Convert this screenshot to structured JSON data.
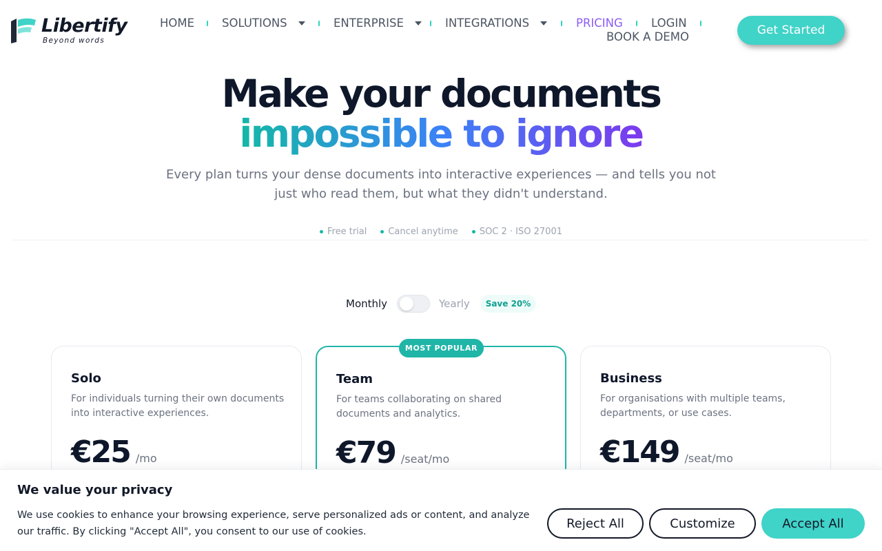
{
  "brand": {
    "name": "Libertify",
    "tagline": "Beyond words",
    "logo_icon": "libertify-logo-icon",
    "accent_color": "#40d3c8",
    "teal_color": "#14b8a6",
    "purple_color": "#7c3aed"
  },
  "nav": {
    "items": [
      {
        "label": "HOME",
        "dropdown": false,
        "active": false
      },
      {
        "label": "SOLUTIONS",
        "dropdown": true,
        "active": false
      },
      {
        "label": "ENTERPRISE",
        "dropdown": true,
        "active": false
      },
      {
        "label": "INTEGRATIONS",
        "dropdown": true,
        "active": false
      },
      {
        "label": "PRICING",
        "dropdown": false,
        "active": true
      },
      {
        "label": "LOGIN",
        "dropdown": false,
        "active": false
      },
      {
        "label": "BOOK A DEMO",
        "dropdown": false,
        "active": false
      }
    ],
    "cta_label": "Get Started"
  },
  "hero": {
    "title_line1": "Make your documents",
    "title_line2": "impossible to ignore",
    "subtitle": "Every plan turns your dense documents into interactive experiences — and tells you not just who read them, but what they didn't understand.",
    "trust": [
      "Free trial",
      "Cancel anytime",
      "SOC 2 · ISO 27001"
    ]
  },
  "billing": {
    "monthly_label": "Monthly",
    "yearly_label": "Yearly",
    "save_badge": "Save 20%",
    "selected": "Monthly"
  },
  "plans": [
    {
      "name": "Solo",
      "description": "For individuals turning their own documents into interactive experiences.",
      "price": "€25",
      "unit": "/mo",
      "popular": false
    },
    {
      "name": "Team",
      "description": "For teams collaborating on shared documents and analytics.",
      "price": "€79",
      "unit": "/seat/mo",
      "popular": true,
      "badge": "MOST POPULAR"
    },
    {
      "name": "Business",
      "description": "For organisations with multiple teams, departments, or use cases.",
      "price": "€149",
      "unit": "/seat/mo",
      "popular": false
    }
  ],
  "cookie": {
    "title": "We value your privacy",
    "text": "We use cookies to enhance your browsing experience, serve personalized ads or content, and analyze our traffic. By clicking \"Accept All\", you consent to our use of cookies.",
    "reject_label": "Reject All",
    "customize_label": "Customize",
    "accept_label": "Accept All"
  }
}
